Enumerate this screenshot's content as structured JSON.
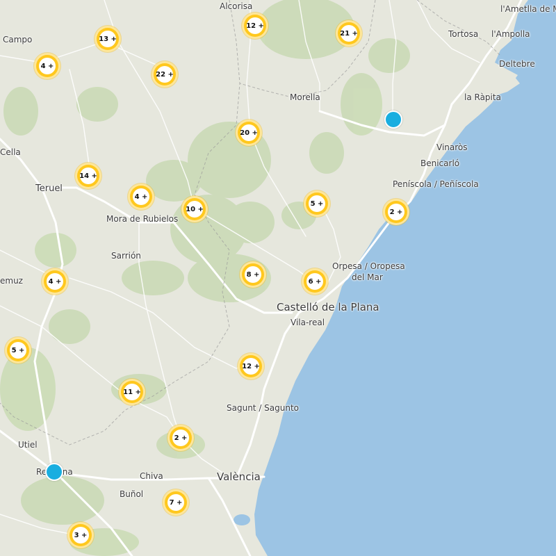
{
  "colors": {
    "land": "#e6e7dd",
    "sea": "#9cc4e4",
    "vegetation": "#c9dab4",
    "road": "#ffffff",
    "cluster_ring": "#ffc81e",
    "cluster_halo": "#fde69a",
    "point_marker": "#19aee0"
  },
  "places": [
    {
      "id": "alcorisa",
      "name": "Alcorisa"
    },
    {
      "id": "ametlla",
      "name": "l'Ametlla de Mar"
    },
    {
      "id": "campo",
      "name": "Campo"
    },
    {
      "id": "tortosa",
      "name": "Tortosa"
    },
    {
      "id": "ampolla",
      "name": "l'Ampolla"
    },
    {
      "id": "deltebre",
      "name": "Deltebre"
    },
    {
      "id": "morella",
      "name": "Morella"
    },
    {
      "id": "rapita",
      "name": "la Ràpita"
    },
    {
      "id": "cella",
      "name": "Cella"
    },
    {
      "id": "vinaros",
      "name": "Vinaròs"
    },
    {
      "id": "benicarlo",
      "name": "Benicarló"
    },
    {
      "id": "teruel",
      "name": "Teruel"
    },
    {
      "id": "peniscola",
      "name": "Peníscola / Peñíscola"
    },
    {
      "id": "mora",
      "name": "Mora de Rubielos"
    },
    {
      "id": "sarrion",
      "name": "Sarrión"
    },
    {
      "id": "orpesa1",
      "name": "Orpesa / Oropesa"
    },
    {
      "id": "orpesa2",
      "name": "del Mar"
    },
    {
      "id": "emuz",
      "name": "emuz"
    },
    {
      "id": "castello",
      "name": "Castelló de la Plana"
    },
    {
      "id": "vilareal",
      "name": "Vila-real"
    },
    {
      "id": "sagunt",
      "name": "Sagunt / Sagunto"
    },
    {
      "id": "utiel",
      "name": "Utiel"
    },
    {
      "id": "requena",
      "name": "Requena"
    },
    {
      "id": "chiva",
      "name": "Chiva"
    },
    {
      "id": "valencia",
      "name": "València"
    },
    {
      "id": "bunol",
      "name": "Buñol"
    }
  ],
  "clusters": [
    {
      "label": "13 +",
      "count": 13
    },
    {
      "label": "12 +",
      "count": 12
    },
    {
      "label": "21 +",
      "count": 21
    },
    {
      "label": "4 +",
      "count": 4
    },
    {
      "label": "22 +",
      "count": 22
    },
    {
      "label": "20 +",
      "count": 20
    },
    {
      "label": "14 +",
      "count": 14
    },
    {
      "label": "4 +",
      "count": 4
    },
    {
      "label": "10 +",
      "count": 10
    },
    {
      "label": "5 +",
      "count": 5
    },
    {
      "label": "2 +",
      "count": 2
    },
    {
      "label": "8 +",
      "count": 8
    },
    {
      "label": "6 +",
      "count": 6
    },
    {
      "label": "4 +",
      "count": 4
    },
    {
      "label": "5 +",
      "count": 5
    },
    {
      "label": "12 +",
      "count": 12
    },
    {
      "label": "11 +",
      "count": 11
    },
    {
      "label": "2 +",
      "count": 2
    },
    {
      "label": "7 +",
      "count": 7
    },
    {
      "label": "3 +",
      "count": 3
    }
  ],
  "points": [
    {
      "id": "marker-north"
    },
    {
      "id": "marker-requena"
    }
  ]
}
